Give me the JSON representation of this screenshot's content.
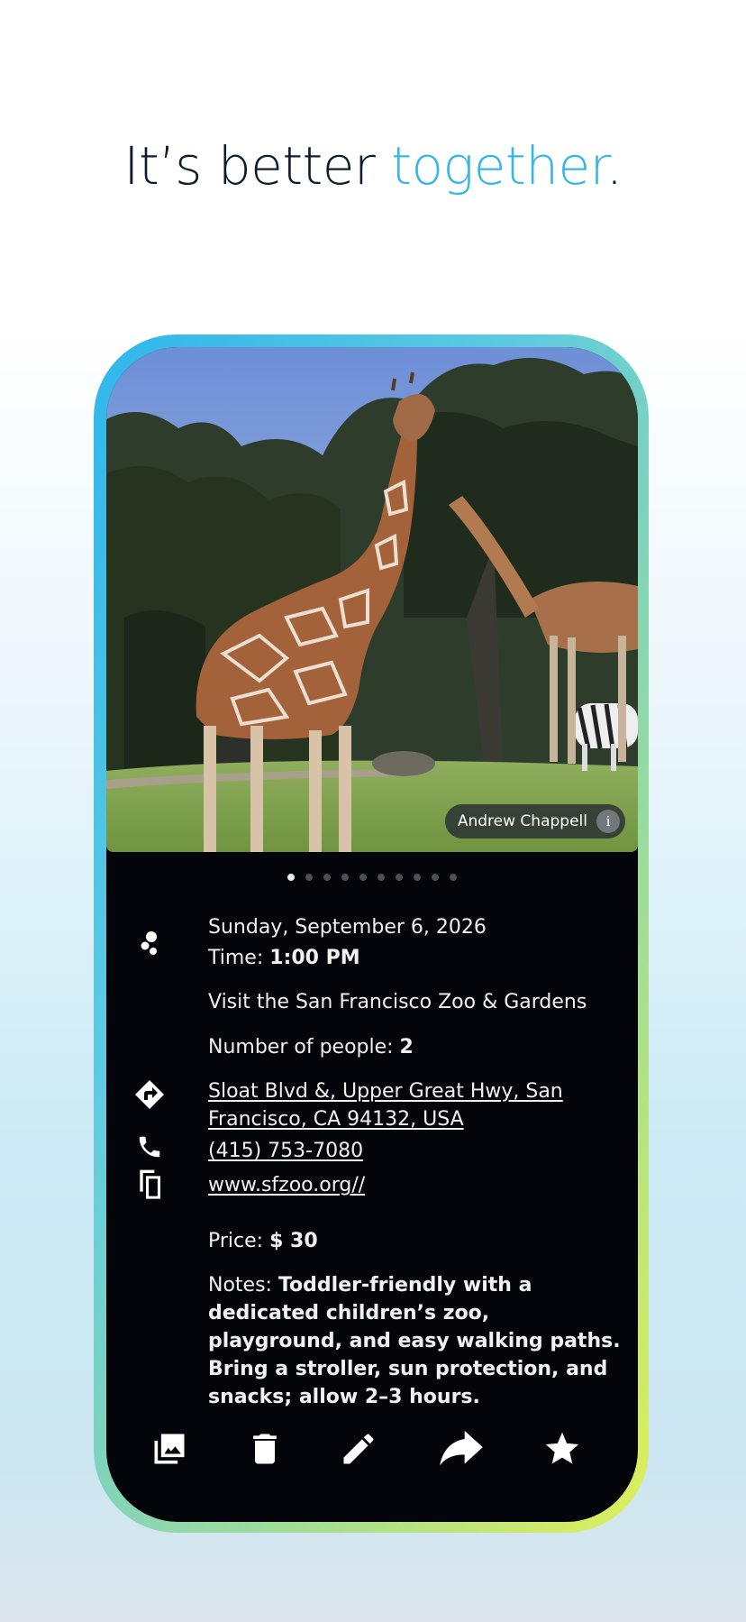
{
  "headline": {
    "part1": "It’s better ",
    "accent": "together",
    "period": "."
  },
  "photo": {
    "credit": "Andrew Chappell",
    "info_glyph": "i",
    "total_slides": 10,
    "active_slide": 1
  },
  "event": {
    "date": "Sunday, September 6, 2026",
    "time_label": "Time: ",
    "time_value": "1:00 PM",
    "title": "Visit the San Francisco Zoo & Gardens",
    "people_label": "Number of people: ",
    "people_value": "2",
    "address_line1": "Sloat Blvd &, Upper Great Hwy, San",
    "address_line2": "Francisco, CA 94132, USA",
    "phone": "(415) 753-7080",
    "website": "www.sfzoo.org//",
    "price_label": "Price: ",
    "price_value": "$ 30",
    "notes_label": "Notes: ",
    "notes_value": "Toddler-friendly with a dedicated children’s zoo, playground, and easy walking paths. Bring a stroller, sun protection, and snacks; allow 2–3 hours."
  },
  "icons": {
    "event_type": "bubbles-icon",
    "directions": "directions-icon",
    "phone": "phone-icon",
    "copy": "copy-icon"
  },
  "toolbar": [
    "gallery-icon",
    "trash-icon",
    "edit-icon",
    "share-icon",
    "star-icon"
  ],
  "colors": {
    "accent": "#37b8e3",
    "headline": "#0e1b2c",
    "card_bg": "#03050b"
  }
}
